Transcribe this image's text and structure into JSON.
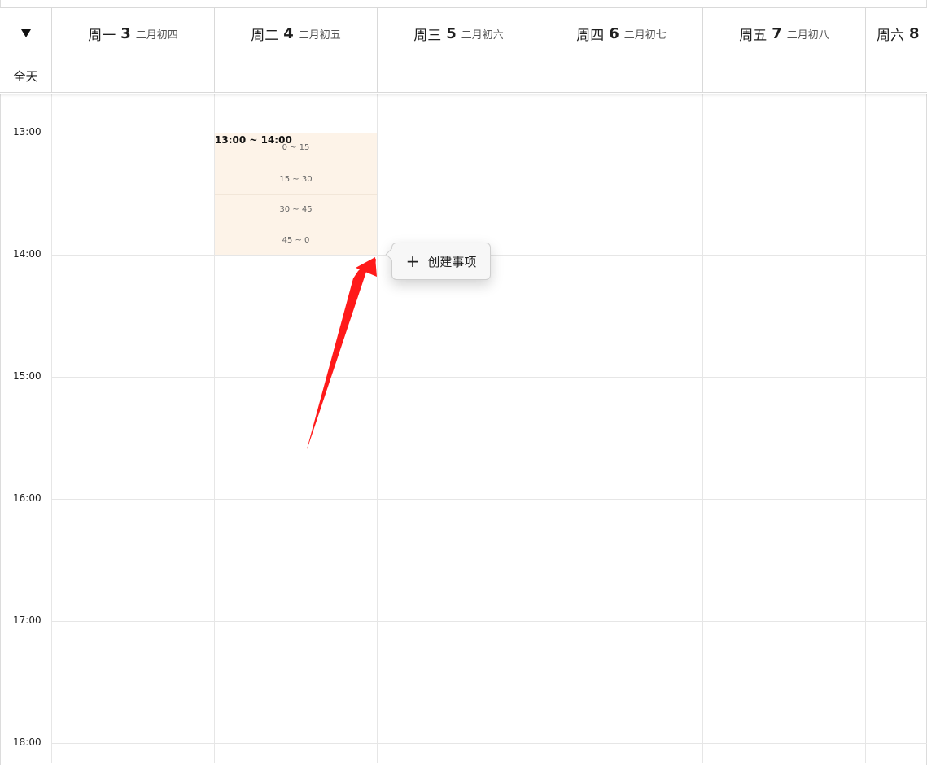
{
  "header": {
    "toggle_icon": "triangle-down-icon",
    "days": [
      {
        "weekday": "周一",
        "date": "3",
        "lunar": "二月初四"
      },
      {
        "weekday": "周二",
        "date": "4",
        "lunar": "二月初五"
      },
      {
        "weekday": "周三",
        "date": "5",
        "lunar": "二月初六"
      },
      {
        "weekday": "周四",
        "date": "6",
        "lunar": "二月初七"
      },
      {
        "weekday": "周五",
        "date": "7",
        "lunar": "二月初八"
      },
      {
        "weekday": "周六",
        "date": "8",
        "lunar": ""
      }
    ],
    "allday_label": "全天"
  },
  "times": [
    "13:00",
    "14:00",
    "15:00",
    "16:00",
    "17:00",
    "18:00"
  ],
  "selection": {
    "range": "13:00 ~ 14:00",
    "slots": [
      "0 ~ 15",
      "15 ~ 30",
      "30 ~ 45",
      "45 ~ 0"
    ],
    "color": "#fdf3e8"
  },
  "popover": {
    "icon": "plus-icon",
    "label": "创建事项"
  },
  "annotation": {
    "color": "#ff0000",
    "icon": "red-arrow-icon"
  }
}
